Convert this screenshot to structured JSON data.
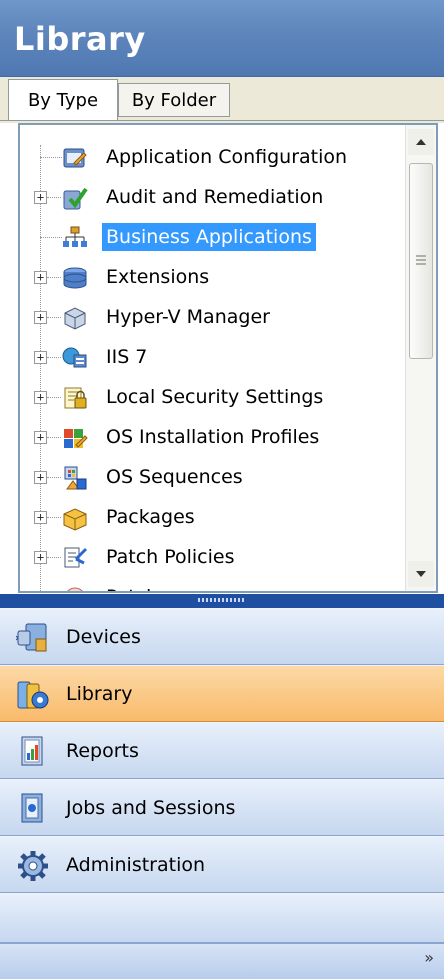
{
  "header": {
    "title": "Library"
  },
  "tabs": [
    {
      "label": "By Type",
      "active": true
    },
    {
      "label": "By Folder",
      "active": false
    }
  ],
  "tree": {
    "items": [
      {
        "label": "Application Configuration",
        "icon": "app-config-icon",
        "expandable": false,
        "selected": false
      },
      {
        "label": "Audit and Remediation",
        "icon": "audit-icon",
        "expandable": true,
        "selected": false
      },
      {
        "label": "Business Applications",
        "icon": "org-chart-icon",
        "expandable": false,
        "selected": true
      },
      {
        "label": "Extensions",
        "icon": "extensions-icon",
        "expandable": true,
        "selected": false
      },
      {
        "label": "Hyper-V Manager",
        "icon": "hyperv-icon",
        "expandable": true,
        "selected": false
      },
      {
        "label": "IIS 7",
        "icon": "iis-icon",
        "expandable": true,
        "selected": false
      },
      {
        "label": "Local Security Settings",
        "icon": "security-icon",
        "expandable": true,
        "selected": false
      },
      {
        "label": "OS Installation Profiles",
        "icon": "os-profiles-icon",
        "expandable": true,
        "selected": false
      },
      {
        "label": "OS Sequences",
        "icon": "os-sequences-icon",
        "expandable": true,
        "selected": false
      },
      {
        "label": "Packages",
        "icon": "packages-icon",
        "expandable": true,
        "selected": false
      },
      {
        "label": "Patch Policies",
        "icon": "patch-policies-icon",
        "expandable": true,
        "selected": false
      },
      {
        "label": "Patches",
        "icon": "patches-icon",
        "expandable": true,
        "selected": false
      }
    ]
  },
  "nav": {
    "items": [
      {
        "label": "Devices",
        "icon": "devices-icon",
        "active": false
      },
      {
        "label": "Library",
        "icon": "library-icon",
        "active": true
      },
      {
        "label": "Reports",
        "icon": "reports-icon",
        "active": false
      },
      {
        "label": "Jobs and Sessions",
        "icon": "jobs-icon",
        "active": false
      },
      {
        "label": "Administration",
        "icon": "gear-icon",
        "active": false
      }
    ],
    "overflow": "»"
  },
  "colors": {
    "header": "#5f87bd",
    "selected": "#3399ff",
    "active_nav": "#f9ba6b",
    "splitter": "#1f4fa0"
  }
}
